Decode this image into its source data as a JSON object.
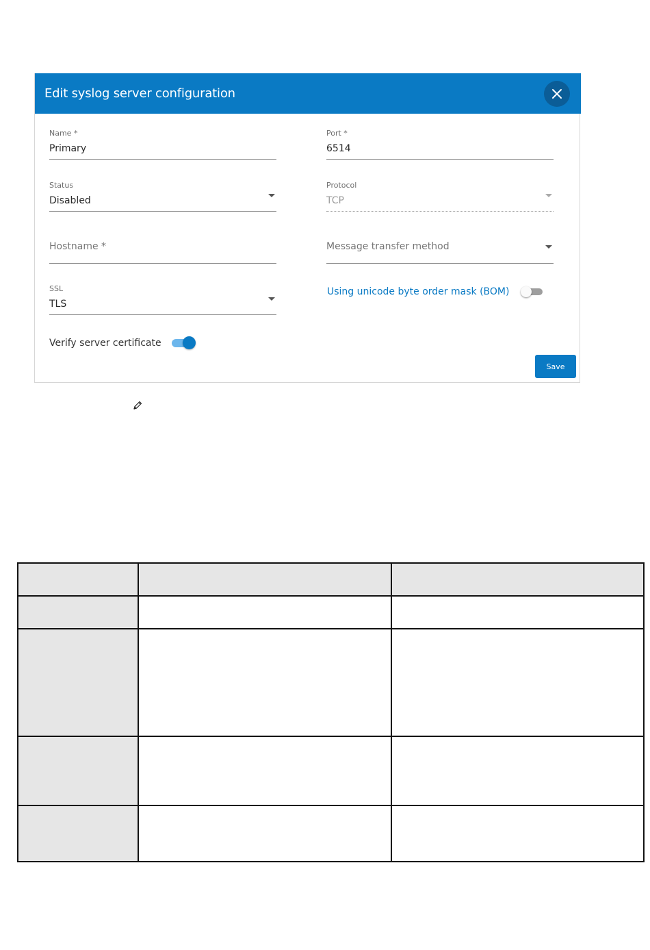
{
  "dialog": {
    "title": "Edit syslog server configuration",
    "close_icon": "close-icon",
    "fields": {
      "name": {
        "label": "Name *",
        "value": "Primary"
      },
      "port": {
        "label": "Port *",
        "value": "6514"
      },
      "status": {
        "label": "Status",
        "value": "Disabled"
      },
      "protocol": {
        "label": "Protocol",
        "value": "TCP"
      },
      "hostname": {
        "placeholder": "Hostname *"
      },
      "message_transfer": {
        "placeholder": "Message transfer method"
      },
      "ssl": {
        "label": "SSL",
        "value": "TLS"
      }
    },
    "bom_toggle": {
      "label": "Using unicode byte order mask (BOM)",
      "on": false
    },
    "verify_toggle": {
      "label": "Verify server certificate",
      "on": true
    },
    "save_label": "Save",
    "accent_color": "#0a7ac4"
  },
  "pencil_icon": "pencil-icon",
  "table": {
    "header": [
      "",
      "",
      ""
    ],
    "rows": [
      [
        "",
        "",
        ""
      ],
      [
        "",
        "",
        ""
      ],
      [
        "",
        "",
        ""
      ],
      [
        "",
        "",
        ""
      ]
    ]
  }
}
